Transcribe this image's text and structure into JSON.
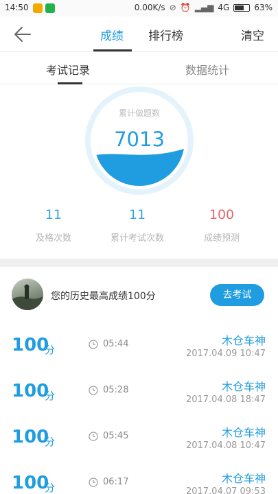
{
  "status_bar": {
    "time": "14:50",
    "net_speed": "0.00K/s",
    "network": "4G",
    "battery_percent": "63%",
    "battery_level": 0.63,
    "app_icon_colors": [
      "#f2a900",
      "#22b14c"
    ]
  },
  "header": {
    "back_icon": "arrow-left-icon",
    "tabs": [
      {
        "label": "成绩",
        "active": true
      },
      {
        "label": "排行榜",
        "active": false
      }
    ],
    "clear_label": "清空"
  },
  "subtabs": [
    {
      "label": "考试记录",
      "active": true
    },
    {
      "label": "数据统计",
      "active": false
    }
  ],
  "gauge": {
    "label": "累计做题数",
    "value": "7013",
    "fill_level": 0.35,
    "color": "#1f9de0"
  },
  "stats": [
    {
      "value": "11",
      "label": "及格次数"
    },
    {
      "value": "11",
      "label": "累计考试次数"
    },
    {
      "value": "100",
      "label": "成绩预测"
    }
  ],
  "best": {
    "text": "您的历史最高成绩100分",
    "button_label": "去考试"
  },
  "records": [
    {
      "score": "100",
      "unit": "分",
      "duration": "05:44",
      "name": "木仓车神",
      "date": "2017.04.09  10:47"
    },
    {
      "score": "100",
      "unit": "分",
      "duration": "05:28",
      "name": "木仓车神",
      "date": "2017.04.08  18:47"
    },
    {
      "score": "100",
      "unit": "分",
      "duration": "05:45",
      "name": "木仓车神",
      "date": "2017.04.08  10:47"
    },
    {
      "score": "100",
      "unit": "分",
      "duration": "06:17",
      "name": "木仓车神",
      "date": "2017.04.07  09:53"
    }
  ],
  "colors": {
    "accent": "#1f9de0",
    "prediction": "#e06b6b"
  }
}
